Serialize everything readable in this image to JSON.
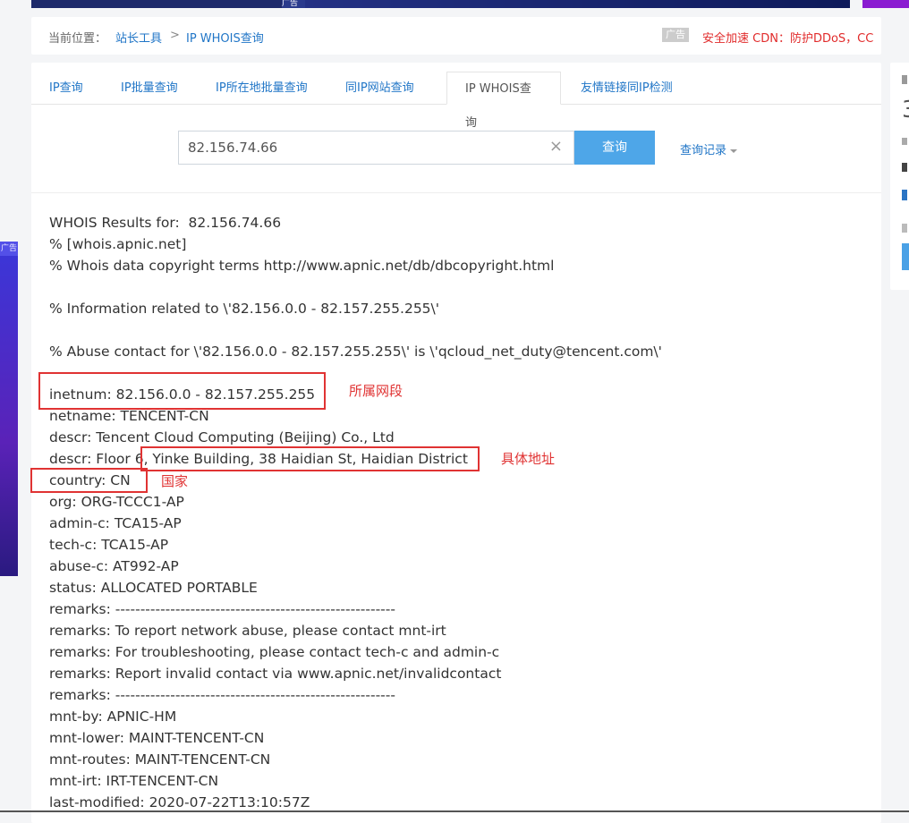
{
  "top_ad": {
    "badge": "广告"
  },
  "left_ad": {
    "badge": "广告"
  },
  "breadcrumb": {
    "location_label": "当前位置：",
    "items": [
      "站长工具",
      "IP WHOIS查询"
    ],
    "separator": ">",
    "ad_tag": "广告",
    "ad_text": "安全加速 CDN：防护DDoS，CC"
  },
  "tabs": [
    {
      "label": "IP查询"
    },
    {
      "label": "IP批量查询"
    },
    {
      "label": "IP所在地批量查询"
    },
    {
      "label": "同IP网站查询"
    },
    {
      "label": "IP WHOIS查询",
      "active": true
    },
    {
      "label": "友情链接同IP检测"
    }
  ],
  "search": {
    "value": "82.156.74.66",
    "clear_icon": "×",
    "button_label": "查询",
    "history_label": "查询记录"
  },
  "results": {
    "lines": [
      "WHOIS Results for:  82.156.74.66",
      "% [whois.apnic.net]",
      "% Whois data copyright terms http://www.apnic.net/db/dbcopyright.html",
      "",
      "% Information related to \\'82.156.0.0 - 82.157.255.255\\'",
      "",
      "% Abuse contact for \\'82.156.0.0 - 82.157.255.255\\' is \\'qcloud_net_duty@tencent.com\\'",
      "",
      "inetnum: 82.156.0.0 - 82.157.255.255",
      "netname: TENCENT-CN",
      "descr: Tencent Cloud Computing (Beijing) Co., Ltd",
      "descr: Floor 6, Yinke Building, 38 Haidian St, Haidian District",
      "country: CN",
      "org: ORG-TCCC1-AP",
      "admin-c: TCA15-AP",
      "tech-c: TCA15-AP",
      "abuse-c: AT992-AP",
      "status: ALLOCATED PORTABLE",
      "remarks: --------------------------------------------------------",
      "remarks: To report network abuse, please contact mnt-irt",
      "remarks: For troubleshooting, please contact tech-c and admin-c",
      "remarks: Report invalid contact via www.apnic.net/invalidcontact",
      "remarks: --------------------------------------------------------",
      "mnt-by: APNIC-HM",
      "mnt-lower: MAINT-TENCENT-CN",
      "mnt-routes: MAINT-TENCENT-CN",
      "mnt-irt: IRT-TENCENT-CN",
      "last-modified: 2020-07-22T13:10:57Z"
    ]
  },
  "annotations": {
    "inetnum_label": "所属网段",
    "address_label": "具体地址",
    "country_label": "国家"
  },
  "side_panel": {
    "digit": "3"
  },
  "colors": {
    "link": "#2176c7",
    "accent_button": "#4ea6e8",
    "annotation": "#e03333"
  }
}
